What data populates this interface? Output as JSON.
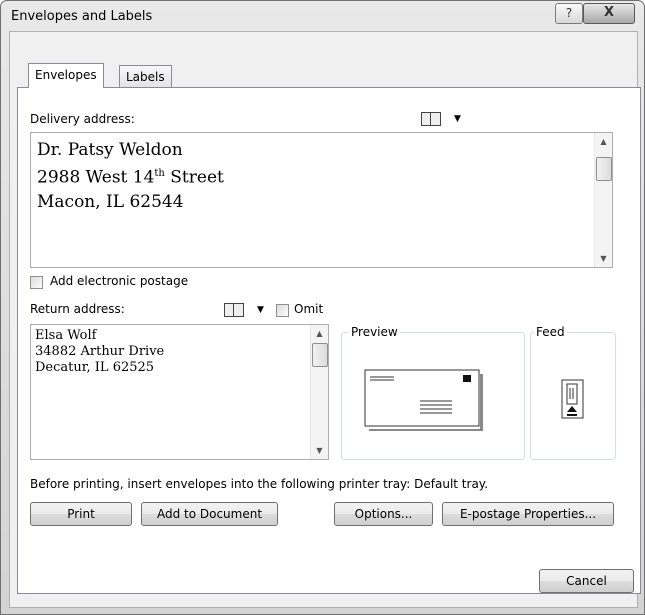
{
  "window": {
    "title": "Envelopes and Labels",
    "help_label": "?",
    "close_label": "X"
  },
  "tabs": [
    {
      "label": "Envelopes",
      "active": true
    },
    {
      "label": "Labels",
      "active": false
    }
  ],
  "delivery": {
    "label": "Delivery address:",
    "lines": [
      "Dr. Patsy Weldon",
      "2988 West 14th Street",
      "Macon, IL 62544"
    ],
    "line2_prefix": "2988 West 14",
    "line2_sup": "th",
    "line2_suffix": " Street"
  },
  "postage": {
    "label": "Add electronic postage",
    "checked": false
  },
  "return_addr": {
    "label": "Return address:",
    "omit_label": "Omit",
    "omit_checked": false,
    "lines": [
      "Elsa Wolf",
      "34882 Arthur Drive",
      "Decatur, IL 62525"
    ]
  },
  "preview": {
    "label": "Preview"
  },
  "feed": {
    "label": "Feed"
  },
  "tray_note": "Before printing, insert envelopes into the following printer tray: Default tray.",
  "buttons": {
    "print": "Print",
    "add_to_document": "Add to Document",
    "options": "Options...",
    "epostage": "E-postage Properties...",
    "cancel": "Cancel"
  },
  "icons": {
    "address_book": "address-book-icon",
    "dropdown": "chevron-down-icon"
  }
}
